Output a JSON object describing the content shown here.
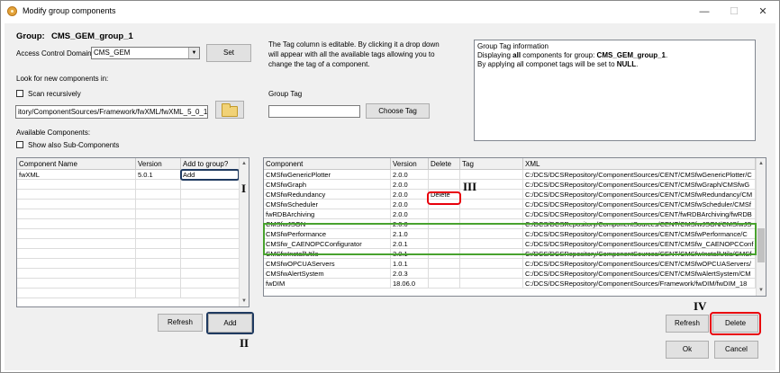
{
  "window": {
    "title": "Modify group components",
    "minimize": "—",
    "maximize": "☐",
    "close": "✕"
  },
  "group": {
    "label": "Group:",
    "name": "CMS_GEM_group_1"
  },
  "access": {
    "label": "Access Control Domain",
    "value": "CMS_GEM",
    "set_button": "Set"
  },
  "tag_help": {
    "line1": "The Tag column is editable. By clicking it a drop down",
    "line2": "will appear with all the available tags allowing you to",
    "line3": "change the tag of a component."
  },
  "info": {
    "title": "Group Tag information",
    "line2_prefix": "Displaying ",
    "line2_bold1": "all",
    "line2_mid": " components for group: ",
    "line2_bold2": "CMS_GEM_group_1",
    "line2_end": ".",
    "line3_prefix": "By applying all componet tags will be set to ",
    "line3_bold": "NULL",
    "line3_end": "."
  },
  "look": {
    "label": "Look for new components in:",
    "scan_label": "Scan recursively",
    "path": "itory/ComponentSources/Framework/fwXML/fwXML_5_0_1/"
  },
  "group_tag": {
    "label": "Group Tag",
    "value": "",
    "choose_button": "Choose Tag"
  },
  "available": {
    "label": "Available Components:",
    "show_sub_label": "Show also Sub-Components"
  },
  "left_table": {
    "headers": [
      "Component Name",
      "Version",
      "Add to group?"
    ],
    "rows": [
      [
        "fwXML",
        "5.0.1",
        "Add"
      ]
    ],
    "empty_rows": 12
  },
  "right_table": {
    "headers": [
      "Component",
      "Version",
      "Delete",
      "Tag",
      "XML"
    ],
    "rows": [
      [
        "CMSfwGenericPlotter",
        "2.0.0",
        "",
        "",
        "C:/DCS/DCSRepository/ComponentSources/CENT/CMSfwGenericPlotter/C"
      ],
      [
        "CMSfwGraph",
        "2.0.0",
        "",
        "",
        "C:/DCS/DCSRepository/ComponentSources/CENT/CMSfwGraph/CMSfwG"
      ],
      [
        "CMSfwRedundancy",
        "2.0.0",
        "Delete",
        "",
        "C:/DCS/DCSRepository/ComponentSources/CENT/CMSfwRedundancy/CM"
      ],
      [
        "CMSfwScheduler",
        "2.0.0",
        "",
        "",
        "C:/DCS/DCSRepository/ComponentSources/CENT/CMSfwScheduler/CMSf"
      ],
      [
        "fwRDBArchiving",
        "2.0.0",
        "",
        "",
        "C:/DCS/DCSRepository/ComponentSources/CENT/fwRDBArchiving/fwRDB"
      ],
      [
        "CMSfwJSON",
        "2.0.0",
        "",
        "",
        "C:/DCS/DCSRepository/ComponentSources/CENT/CMSfwJSON/CMSfwJS"
      ],
      [
        "CMSfwPerformance",
        "2.1.0",
        "",
        "",
        "C:/DCS/DCSRepository/ComponentSources/CENT/CMSfwPerformance/C"
      ],
      [
        "CMSfw_CAENOPCConfigurator",
        "2.0.1",
        "",
        "",
        "C:/DCS/DCSRepository/ComponentSources/CENT/CMSfw_CAENOPCConf"
      ],
      [
        "CMSfwInstallUtils",
        "3.0.1",
        "",
        "",
        "C:/DCS/DCSRepository/ComponentSources/CENT/CMSfwInstallUtils/CMSf"
      ],
      [
        "CMSfwOPCUAServers",
        "1.0.1",
        "",
        "",
        "C:/DCS/DCSRepository/ComponentSources/CENT/CMSfwOPCUAServers/"
      ],
      [
        "CMSfwAlertSystem",
        "2.0.3",
        "",
        "",
        "C:/DCS/DCSRepository/ComponentSources/CENT/CMSfwAlertSystem/CM"
      ],
      [
        "fwDIM",
        "18.06.0",
        "",
        "",
        "C:/DCS/DCSRepository/ComponentSources/Framework/fwDIM/fwDIM_18"
      ]
    ]
  },
  "buttons": {
    "refresh_left": "Refresh",
    "add": "Add",
    "refresh_right": "Refresh",
    "delete": "Delete",
    "ok": "Ok",
    "cancel": "Cancel"
  },
  "annotations": {
    "I": "I",
    "II": "II",
    "III": "III",
    "IV": "IV"
  },
  "colors": {
    "highlight_red": "#e8000b",
    "highlight_green": "#48a22e",
    "add_cell_border": "#1f3a60"
  },
  "icons": {
    "app": "app-gear-icon",
    "folder": "folder-icon",
    "dropdown": "chevron-down-icon"
  }
}
